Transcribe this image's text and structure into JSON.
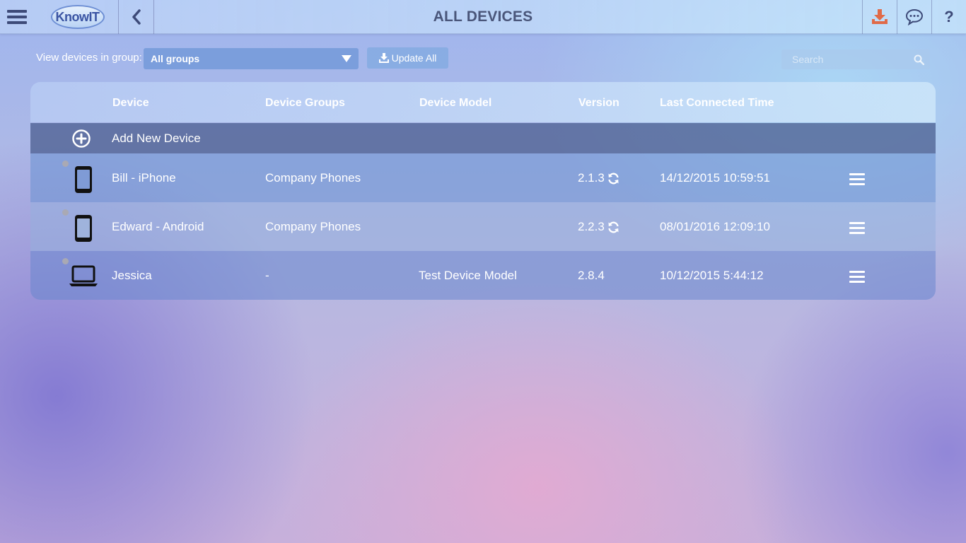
{
  "header": {
    "logo_text": "KnowIT",
    "title": "ALL DEVICES",
    "help_label": "?",
    "icons": [
      "hamburger-menu-icon",
      "chevron-left-icon",
      "download-icon",
      "chat-bubble-icon",
      "help-icon"
    ],
    "download_icon_color": "#e06a48"
  },
  "toolbar": {
    "group_label": "View devices in group:",
    "group_selected": "All groups",
    "update_all_label": "Update All",
    "search_placeholder": "Search"
  },
  "table": {
    "columns": [
      "Device",
      "Device Groups",
      "Device Model",
      "Version",
      "Last Connected Time"
    ],
    "add_new_label": "Add New Device",
    "rows": [
      {
        "icon": "phone-icon",
        "device": "Bill - iPhone",
        "group": "Company Phones",
        "model": "",
        "version": "2.1.3",
        "update_icon": true,
        "last_connected": "14/12/2015 10:59:51"
      },
      {
        "icon": "phone-icon",
        "device": "Edward - Android",
        "group": "Company Phones",
        "model": "",
        "version": "2.2.3",
        "update_icon": true,
        "last_connected": "08/01/2016 12:09:10"
      },
      {
        "icon": "laptop-icon",
        "device": "Jessica",
        "group": "-",
        "model": "Test Device Model",
        "version": "2.8.4",
        "update_icon": false,
        "last_connected": "10/12/2015 5:44:12"
      }
    ]
  }
}
